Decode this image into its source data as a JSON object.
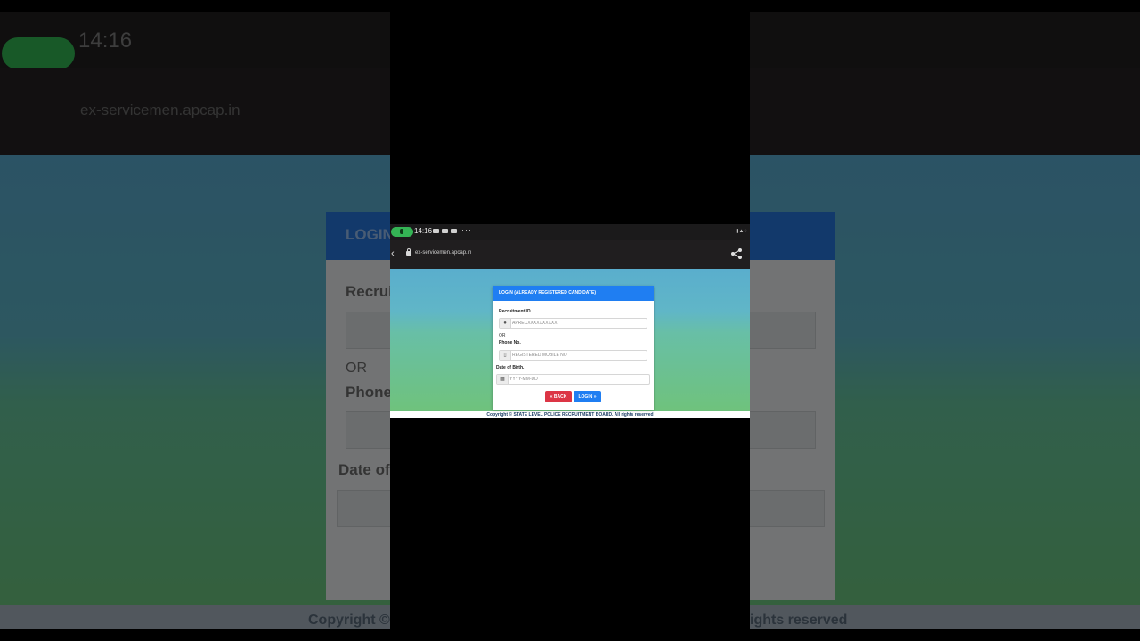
{
  "status_bar": {
    "time": "14:16"
  },
  "browser": {
    "url": "ex-servicemen.apcap.in"
  },
  "login_card": {
    "title": "LOGIN (ALREADY REGISTERED CANDIDATE)",
    "recruitment_id_label": "Recruitment ID",
    "recruitment_id_placeholder": "APRECXXXXXXXXXX",
    "or_text": "OR",
    "phone_label": "Phone No.",
    "phone_placeholder": "REGISTERED MOBILE NO",
    "dob_label": "Date of Birth.",
    "dob_placeholder": "YYYY-MM-DD",
    "back_button": "« BACK",
    "login_button": "LOGIN »"
  },
  "footer": {
    "copyright": "Copyright © STATE LEVEL POLICE RECRUITMENT BOARD. All rights reserved"
  },
  "background_blur": {
    "heading_fragment": "LOGIN",
    "recruitment_fragment": "Recrui",
    "or_fragment": "OR",
    "phone_fragment": "Phone",
    "dob_fragment": "Date of",
    "footer_left_fragment": "Copyright ©",
    "footer_right_fragment": "ights reserved"
  },
  "colors": {
    "primary": "#1f7ef2",
    "danger": "#dc3545",
    "mic_active": "#34b455"
  },
  "icons": {
    "mic": "mic-icon",
    "lock": "lock-icon",
    "share": "share-icon",
    "user": "user-icon",
    "mobile": "mobile-icon",
    "calendar": "calendar-icon"
  }
}
